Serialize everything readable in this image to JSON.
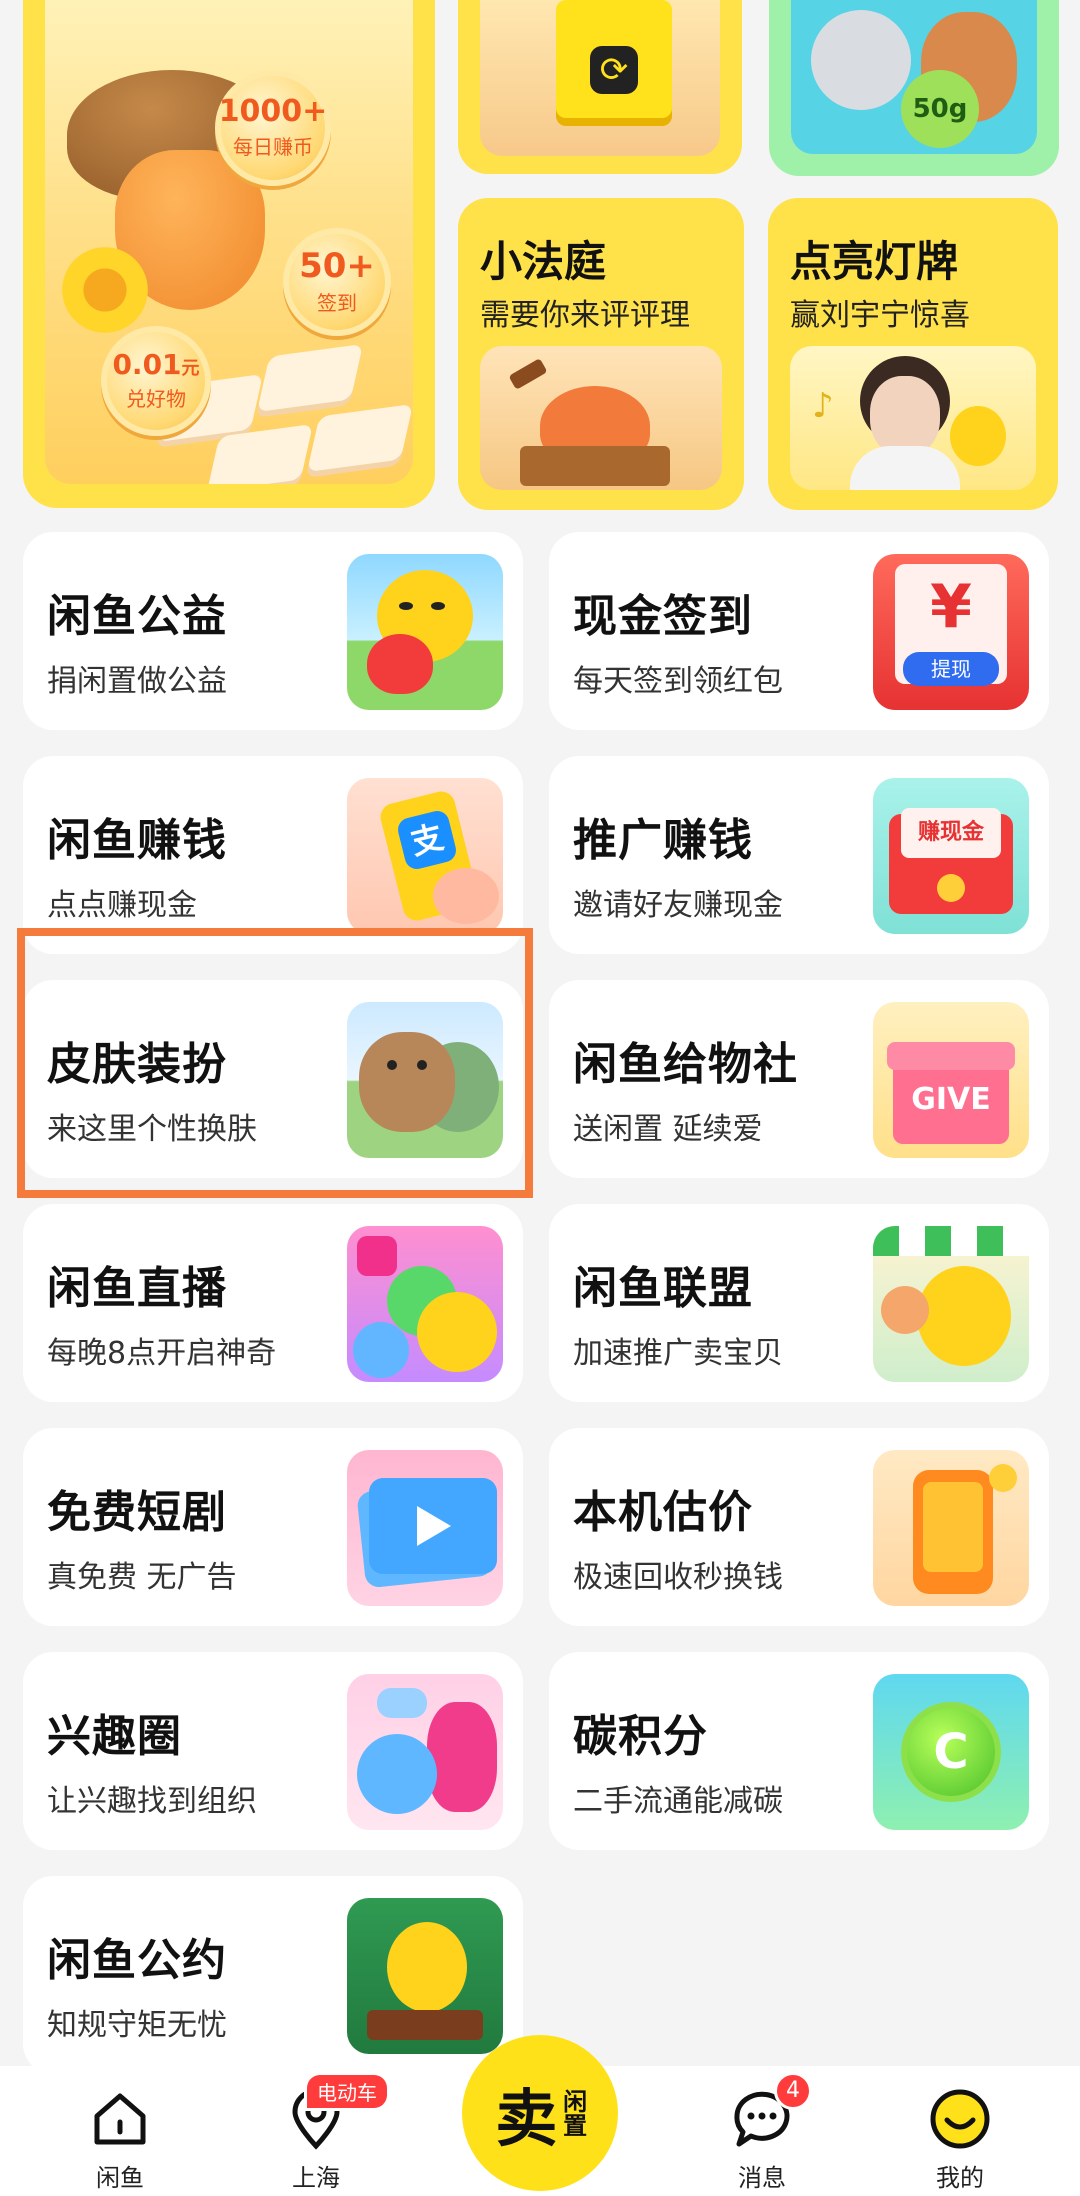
{
  "promo": {
    "big": {
      "coin1_value": "1000+",
      "coin1_label": "每日赚币",
      "coin2_value": "50+",
      "coin2_label": "签到",
      "coin3_value": "0.01",
      "coin3_unit": "元",
      "coin3_label": "兑好物"
    },
    "top_middle_icon": "exchange-box-icon",
    "top_right": {
      "badge": "50g"
    },
    "court": {
      "title": "小法庭",
      "subtitle": "需要你来评评理"
    },
    "lightup": {
      "title": "点亮灯牌",
      "subtitle": "赢刘宇宁惊喜"
    }
  },
  "cards": [
    {
      "title": "闲鱼公益",
      "subtitle": "捐闲置做公益",
      "icon": "heart-fish-icon"
    },
    {
      "title": "现金签到",
      "subtitle": "每天签到领红包",
      "icon": "red-envelope-icon",
      "icon_text_1": "¥",
      "icon_text_2": "提现"
    },
    {
      "title": "闲鱼赚钱",
      "subtitle": "点点赚现金",
      "icon": "alipay-phone-icon",
      "icon_text_1": "支"
    },
    {
      "title": "推广赚钱",
      "subtitle": "邀请好友赚现金",
      "icon": "earn-cash-envelope-icon",
      "icon_text_1": "赚现金"
    },
    {
      "title": "皮肤装扮",
      "subtitle": "来这里个性换肤",
      "icon": "capybara-sticker-icon"
    },
    {
      "title": "闲鱼给物社",
      "subtitle": "送闲置 延续爱",
      "icon": "gift-box-icon",
      "icon_text_1": "GIVE"
    },
    {
      "title": "闲鱼直播",
      "subtitle": "每晚8点开启神奇",
      "icon": "live-stream-icon"
    },
    {
      "title": "闲鱼联盟",
      "subtitle": "加速推广卖宝贝",
      "icon": "fish-shop-icon"
    },
    {
      "title": "免费短剧",
      "subtitle": "真免费 无广告",
      "icon": "video-play-icon"
    },
    {
      "title": "本机估价",
      "subtitle": "极速回收秒换钱",
      "icon": "orange-phone-icon"
    },
    {
      "title": "兴趣圈",
      "subtitle": "让兴趣找到组织",
      "icon": "interest-blobs-icon"
    },
    {
      "title": "碳积分",
      "subtitle": "二手流通能减碳",
      "icon": "green-coin-icon",
      "icon_text_1": "C"
    },
    {
      "title": "闲鱼公约",
      "subtitle": "知规守矩无忧",
      "icon": "fish-book-icon"
    }
  ],
  "tabbar": {
    "home": "闲鱼",
    "city": "上海",
    "city_badge": "电动车",
    "sell_main": "卖",
    "sell_side": "闲置",
    "messages": "消息",
    "messages_badge": "4",
    "mine": "我的"
  },
  "colors": {
    "accent_yellow": "#ffe11a",
    "highlight_border": "#f57b3c",
    "badge_red": "#ff3b3b"
  }
}
